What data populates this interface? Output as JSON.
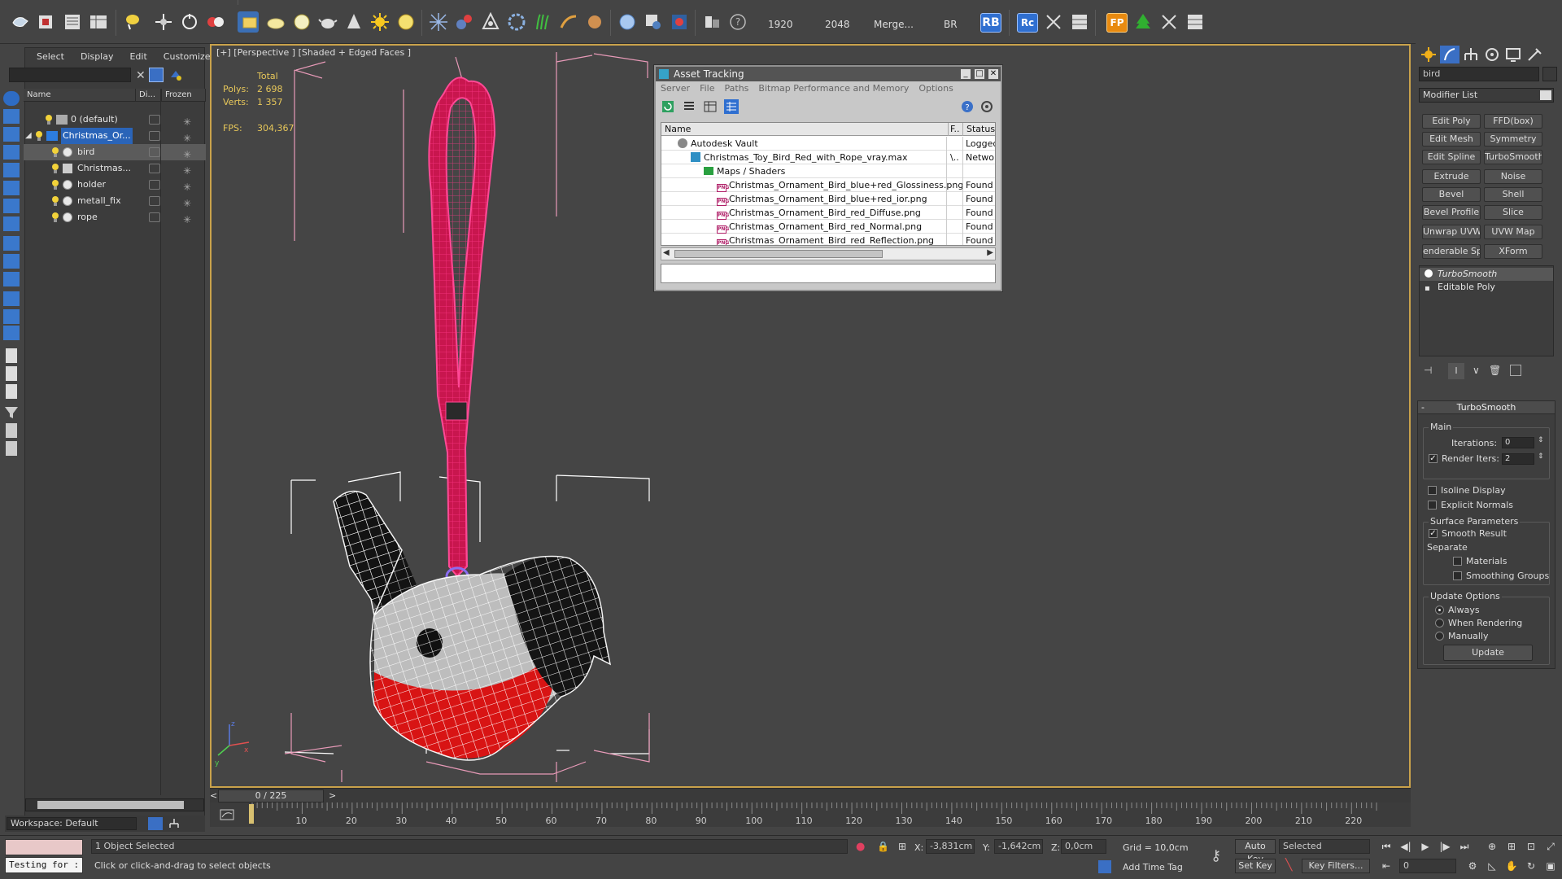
{
  "toolbar": {
    "render_width": "1920",
    "render_height": "2048",
    "merge_label": "Merge...",
    "br_label": "BR",
    "rb_label": "RB",
    "rc_label": "Rc",
    "fp_label": "FP",
    "help_glyph": "?"
  },
  "explorer": {
    "menu": [
      "Select",
      "Display",
      "Edit",
      "Customize"
    ],
    "columns": {
      "name": "Name",
      "display": "Di...",
      "frozen": "Frozen"
    },
    "rows": [
      {
        "label": "0 (default)"
      },
      {
        "label": "Christmas_Or..."
      },
      {
        "label": "bird"
      },
      {
        "label": "Christmas..."
      },
      {
        "label": "holder"
      },
      {
        "label": "metall_fix"
      },
      {
        "label": "rope"
      }
    ],
    "workspace": "Workspace: Default"
  },
  "viewport": {
    "label": "[+] [Perspective ] [Shaded + Edged Faces ]",
    "stats": {
      "total_label": "Total",
      "polys_label": "Polys:",
      "polys": "2 698",
      "verts_label": "Verts:",
      "verts": "1 357",
      "fps_label": "FPS:",
      "fps": "304,367"
    },
    "axis": {
      "x": "x",
      "y": "y",
      "z": "z"
    }
  },
  "asset_tracking": {
    "title": "Asset Tracking",
    "menu": [
      "Server",
      "File",
      "Paths",
      "Bitmap Performance and Memory",
      "Options"
    ],
    "columns": {
      "name": "Name",
      "f": "F..",
      "status": "Status"
    },
    "rows": [
      {
        "name": "Autodesk Vault",
        "f": "",
        "status": "Logged O"
      },
      {
        "name": "Christmas_Toy_Bird_Red_with_Rope_vray.max",
        "f": "\\..",
        "status": "Network"
      },
      {
        "name": "Maps / Shaders",
        "f": "",
        "status": ""
      },
      {
        "name": "Christmas_Ornament_Bird_blue+red_Glossiness.png",
        "f": "",
        "status": "Found"
      },
      {
        "name": "Christmas_Ornament_Bird_blue+red_ior.png",
        "f": "",
        "status": "Found"
      },
      {
        "name": "Christmas_Ornament_Bird_red_Diffuse.png",
        "f": "",
        "status": "Found"
      },
      {
        "name": "Christmas_Ornament_Bird_red_Normal.png",
        "f": "",
        "status": "Found"
      },
      {
        "name": "Christmas_Ornament_Bird_red_Reflection.png",
        "f": "",
        "status": "Found"
      }
    ],
    "png_tag": "PNG"
  },
  "command_panel": {
    "object_name": "bird",
    "modifier_list": "Modifier List",
    "modifier_buttons": [
      "Edit Poly",
      "FFD(box)",
      "Edit Mesh",
      "Symmetry",
      "Edit Spline",
      "TurboSmooth",
      "Extrude",
      "Noise",
      "Bevel",
      "Shell",
      "Bevel Profile",
      "Slice",
      "Unwrap UVW",
      "UVW Map",
      "enderable Splir",
      "XForm"
    ],
    "stack": [
      "TurboSmooth",
      "Editable Poly"
    ],
    "turbosmooth": {
      "title": "TurboSmooth",
      "collapse": "-",
      "main_label": "Main",
      "iterations_label": "Iterations:",
      "iterations": "0",
      "render_iters_label": "Render Iters:",
      "render_iters": "2",
      "isoline_label": "Isoline Display",
      "explicit_normals_label": "Explicit Normals",
      "surface_params_label": "Surface Parameters",
      "smooth_result_label": "Smooth Result",
      "separate_label": "Separate",
      "materials_label": "Materials",
      "smoothing_groups_label": "Smoothing Groups",
      "update_options_label": "Update Options",
      "always_label": "Always",
      "when_rendering_label": "When Rendering",
      "manually_label": "Manually",
      "update_button": "Update"
    }
  },
  "timeline": {
    "frame_display": "0 / 225",
    "prev": "<",
    "next": ">",
    "ticks": [
      "10",
      "20",
      "30",
      "40",
      "50",
      "60",
      "70",
      "80",
      "90",
      "100",
      "110",
      "120",
      "130",
      "140",
      "150",
      "160",
      "170",
      "180",
      "190",
      "200",
      "210",
      "220"
    ]
  },
  "status": {
    "maxscript_text": "Testing for :",
    "selection": "1 Object Selected",
    "prompt": "Click or click-and-drag to select objects",
    "x_label": "X:",
    "x": "-3,831cm",
    "y_label": "Y:",
    "y": "-1,642cm",
    "z_label": "Z:",
    "z": "0,0cm",
    "grid": "Grid = 10,0cm",
    "add_time_tag": "Add Time Tag",
    "auto_key": "Auto Key",
    "set_key": "Set Key",
    "selected": "Selected",
    "key_filters": "Key Filters...",
    "current_frame": "0"
  }
}
